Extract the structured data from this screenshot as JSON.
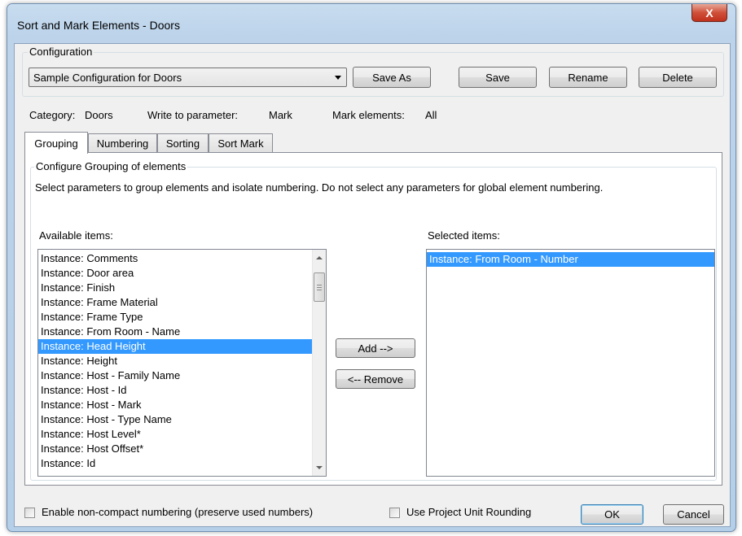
{
  "window": {
    "title": "Sort and Mark Elements - Doors",
    "close_label": "X"
  },
  "configuration": {
    "label": "Configuration",
    "selected": "Sample Configuration for Doors",
    "buttons": {
      "save_as": "Save As",
      "save": "Save",
      "rename": "Rename",
      "delete": "Delete"
    }
  },
  "info": {
    "category_label": "Category:",
    "category_value": "Doors",
    "write_label": "Write to parameter:",
    "write_value": "Mark",
    "mark_label": "Mark elements:",
    "mark_value": "All"
  },
  "tabs": [
    "Grouping",
    "Numbering",
    "Sorting",
    "Sort Mark"
  ],
  "active_tab": "Grouping",
  "grouping": {
    "group_label": "Configure Grouping of elements",
    "description": "Select parameters to group elements and isolate numbering. Do not select any parameters for global element numbering.",
    "available_label": "Available items:",
    "selected_label": "Selected items:",
    "available_items": [
      "Instance: Comments",
      "Instance: Door area",
      "Instance: Finish",
      "Instance: Frame Material",
      "Instance: Frame Type",
      "Instance: From Room - Name",
      "Instance: Head Height",
      "Instance: Height",
      "Instance: Host - Family Name",
      "Instance: Host - Id",
      "Instance: Host - Mark",
      "Instance: Host - Type Name",
      "Instance: Host Level*",
      "Instance: Host Offset*",
      "Instance: Id"
    ],
    "available_selected_index": 6,
    "selected_items": [
      "Instance: From Room - Number"
    ],
    "add_label": "Add -->",
    "remove_label": "<-- Remove"
  },
  "footer": {
    "noncompact_label": "Enable non-compact numbering (preserve used numbers)",
    "rounding_label": "Use Project Unit Rounding",
    "ok_label": "OK",
    "cancel_label": "Cancel"
  },
  "colors": {
    "selection": "#3399ff",
    "close_button": "#c7432a"
  }
}
